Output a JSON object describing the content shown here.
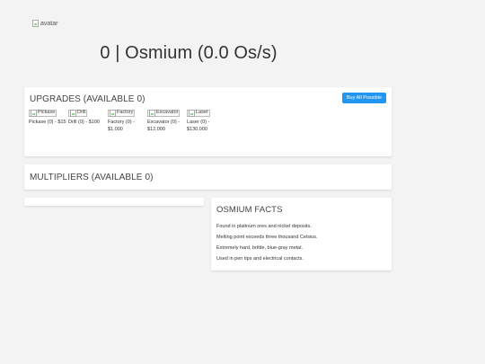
{
  "avatar": {
    "alt": "avatar"
  },
  "header": {
    "headline": "0 | Osmium (0.0 Os/s)"
  },
  "upgrades": {
    "title": "UPGRADES (AVAILABLE 0)",
    "buy_all_label": "Buy All Possible",
    "items": [
      {
        "img_alt": "Pickaxe",
        "label": "Pickaxe (0) - $15"
      },
      {
        "img_alt": "Drill",
        "label": "Drill (0) - $100"
      },
      {
        "img_alt": "Factory",
        "label": "Factory (0) - $1,000"
      },
      {
        "img_alt": "Excavator",
        "label": "Excavator (0) - $12,000"
      },
      {
        "img_alt": "Laser",
        "label": "Laser (0) - $130,000"
      }
    ]
  },
  "multipliers": {
    "title": "MULTIPLIERS (AVAILABLE 0)"
  },
  "facts": {
    "title": "OSMIUM FACTS",
    "items": [
      "Found in platinum ores and nickel deposits.",
      "Melting point exceeds three thousand Celsius.",
      "Extremely hard, brittle, blue-gray metal.",
      "Used in pen tips and electrical contacts."
    ]
  }
}
